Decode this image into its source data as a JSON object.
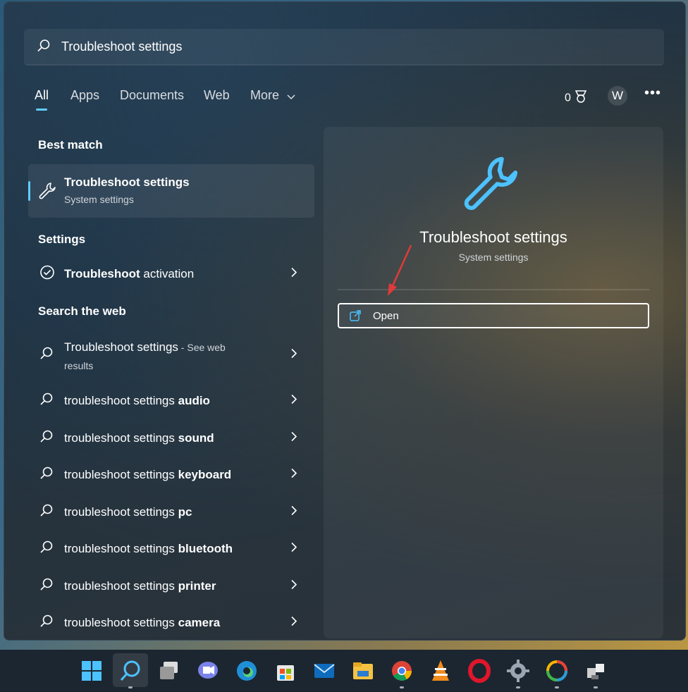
{
  "search": {
    "query": "Troubleshoot settings"
  },
  "tabs": [
    {
      "label": "All",
      "active": true
    },
    {
      "label": "Apps"
    },
    {
      "label": "Documents"
    },
    {
      "label": "Web"
    },
    {
      "label": "More"
    }
  ],
  "header_right": {
    "points": "0",
    "avatar_letter": "W",
    "more_label": "•••"
  },
  "best_match": {
    "section": "Best match",
    "title": "Troubleshoot settings",
    "subtitle": "System settings"
  },
  "settings": {
    "section": "Settings",
    "items": [
      {
        "bold": "Troubleshoot",
        "rest": " activation"
      }
    ]
  },
  "web": {
    "section": "Search the web",
    "first": {
      "bold": "Troubleshoot settings",
      "see": " - See web",
      "results": "results"
    },
    "items": [
      {
        "prefix": "troubleshoot settings ",
        "bold": "audio"
      },
      {
        "prefix": "troubleshoot settings ",
        "bold": "sound"
      },
      {
        "prefix": "troubleshoot settings ",
        "bold": "keyboard"
      },
      {
        "prefix": "troubleshoot settings ",
        "bold": "pc"
      },
      {
        "prefix": "troubleshoot settings ",
        "bold": "bluetooth"
      },
      {
        "prefix": "troubleshoot settings ",
        "bold": "printer"
      },
      {
        "prefix": "troubleshoot settings ",
        "bold": "camera"
      }
    ]
  },
  "preview": {
    "title": "Troubleshoot settings",
    "subtitle": "System settings",
    "open_label": "Open"
  },
  "taskbar": {
    "icons": [
      "windows-start-icon",
      "search-icon",
      "task-view-icon",
      "teams-chat-icon",
      "edge-icon",
      "store-icon",
      "mail-icon",
      "file-explorer-icon",
      "chrome-icon",
      "vlc-icon",
      "opera-icon",
      "settings-icon",
      "photos-icon",
      "network-app-icon"
    ]
  },
  "colors": {
    "accent": "#60cdff",
    "annotation": "#e03a3a"
  }
}
